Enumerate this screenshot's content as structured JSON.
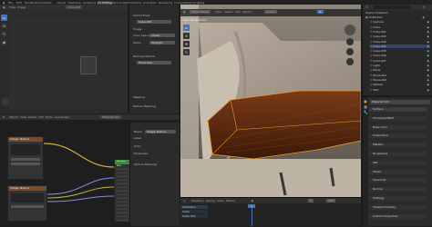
{
  "topbar": {
    "menus": [
      "File",
      "Edit",
      "Render",
      "Window",
      "Help"
    ],
    "tabs": [
      "Layout",
      "Modeling",
      "Sculpting",
      "UV Editing",
      "Texture Paint",
      "Shading",
      "Animation",
      "Rendering",
      "Compositing",
      "Scripting"
    ]
  },
  "image_editor": {
    "header": [
      "View",
      "Image"
    ],
    "image_name": "Cube.004",
    "tools": [
      "select",
      "cursor",
      "annotate",
      "sample"
    ]
  },
  "properties": {
    "rows": [
      "Unfold Fixed",
      "Image",
      "Color Space",
      "Alpha",
      "Packing Options",
      "Mapping",
      "Texture Mapping"
    ],
    "fields": [
      "Cube.004",
      "Linear",
      "Straight",
      "Fixed Size"
    ]
  },
  "node_editor": {
    "header": [
      "Object",
      "View",
      "Select",
      "Add",
      "Node",
      "Use Nodes"
    ],
    "material": "Material.003",
    "nodes": [
      "Image Texture",
      "Image Texture",
      "Principled BSDF"
    ],
    "side_rows": [
      "Name",
      "Label",
      "Color",
      "Properties",
      "Texture Mapping"
    ]
  },
  "viewport": {
    "header": [
      "User Perspective",
      "Object Mode",
      "View",
      "Select",
      "Add",
      "Object",
      "Global"
    ],
    "overlay_label": "User Perspective"
  },
  "timeline": {
    "header": [
      "Playback",
      "Keying",
      "View",
      "Marker"
    ],
    "start": "1",
    "end": "250",
    "current": "1",
    "tracks": [
      "Summary",
      "Cube",
      "Cube.004"
    ]
  },
  "outliner": {
    "title": "Scene Collection",
    "items": [
      "Collection",
      "Camera",
      "Cube",
      "Cube.001",
      "Cube.002",
      "Cube.003",
      "Cube.004",
      "Cube.005",
      "Cube.006",
      "Cube.007",
      "Light",
      "Plane",
      "Plane.001",
      "Plane.002",
      "Sphere",
      "Text"
    ]
  },
  "material_props": {
    "slot": "Material.003",
    "sections": [
      "Surface",
      "Principled BSDF",
      "Base Color",
      "Subsurface",
      "Metallic",
      "Roughness",
      "IOR",
      "Sheen",
      "Clearcoat",
      "Normal",
      "Settings",
      "Viewport Display",
      "Custom Properties"
    ]
  },
  "colors": {
    "accent": "#4772b3",
    "orange": "#e89b2c",
    "green": "#5fa64a"
  }
}
